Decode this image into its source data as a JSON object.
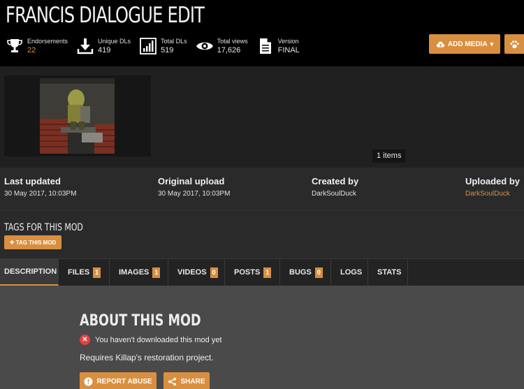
{
  "mod": {
    "title": "FRANCIS DIALOGUE EDIT"
  },
  "stats": [
    {
      "label": "Endorsements",
      "value": "22",
      "icon": "trophy-icon"
    },
    {
      "label": "Unique DLs",
      "value": "419",
      "icon": "download-icon"
    },
    {
      "label": "Total DLs",
      "value": "519",
      "icon": "bar-chart-icon"
    },
    {
      "label": "Total views",
      "value": "17,626",
      "icon": "eye-icon"
    },
    {
      "label": "Version",
      "value": "FINAL",
      "icon": "document-icon"
    }
  ],
  "actions": {
    "add_media": "ADD MEDIA"
  },
  "gallery": {
    "items_count": "1 items"
  },
  "meta": {
    "last_updated_label": "Last updated",
    "last_updated_value": "30 May 2017,  10:03PM",
    "original_upload_label": "Original upload",
    "original_upload_value": "30 May 2017,  10:03PM",
    "created_by_label": "Created by",
    "created_by_value": "DarkSoulDuck",
    "uploaded_by_label": "Uploaded by",
    "uploaded_by_value": "DarkSoulDuck"
  },
  "tags": {
    "title": "TAGS FOR THIS MOD",
    "button": "TAG THIS MOD"
  },
  "tabs": [
    {
      "label": "DESCRIPTION",
      "count": null,
      "active": true
    },
    {
      "label": "FILES",
      "count": "1"
    },
    {
      "label": "IMAGES",
      "count": "1"
    },
    {
      "label": "VIDEOS",
      "count": "0"
    },
    {
      "label": "POSTS",
      "count": "1"
    },
    {
      "label": "BUGS",
      "count": "0"
    },
    {
      "label": "LOGS",
      "count": null
    },
    {
      "label": "STATS",
      "count": null
    }
  ],
  "description": {
    "title": "ABOUT THIS MOD",
    "download_notice": "You haven't downloaded this mod yet",
    "body": "Requires Killap's restoration project.",
    "report_button": "REPORT ABUSE",
    "share_button": "SHARE"
  },
  "colors": {
    "accent": "#d98f40",
    "header_bg": "#000000",
    "content_bg": "#4a4a4a",
    "error": "#e63f3f"
  }
}
